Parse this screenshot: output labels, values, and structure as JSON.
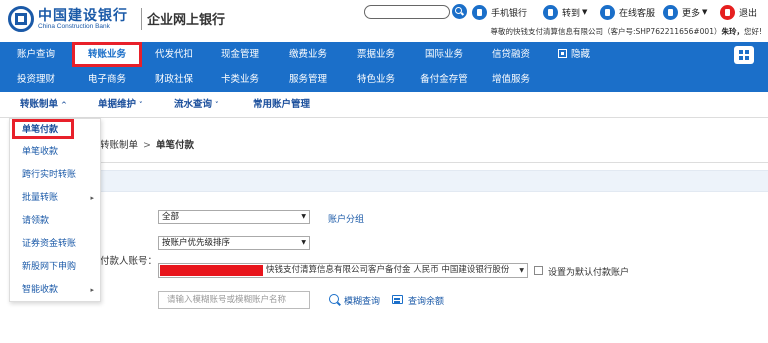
{
  "header": {
    "bank_name_cn": "中国建设银行",
    "bank_name_en": "China Construction Bank",
    "site_name": "企业网上银行",
    "tools": {
      "mobile_bank": "手机银行",
      "go_to": "转到",
      "online_service": "在线客服",
      "more": "更多",
      "logout": "退出"
    },
    "greeting_prefix": "尊敬的快钱支付清算信息有限公司（客户号:SHP762211656#001）",
    "greeting_name": "朱玲，",
    "greeting_suffix": "您好!"
  },
  "nav": {
    "row1": [
      "账户查询",
      "转账业务",
      "代发代扣",
      "现金管理",
      "缴费业务",
      "票据业务",
      "国际业务",
      "信贷融资",
      "隐藏"
    ],
    "row2": [
      "投资理财",
      "电子商务",
      "财政社保",
      "卡类业务",
      "服务管理",
      "特色业务",
      "备付金存管",
      "增值服务"
    ],
    "active": "转账业务"
  },
  "subnav": {
    "items": [
      "转账制单",
      "单据维护",
      "流水查询",
      "常用账户管理"
    ]
  },
  "dropdown": {
    "items": [
      "单笔付款",
      "单笔收款",
      "跨行实时转账",
      "批量转账",
      "请领款",
      "证券资金转账",
      "新股网下申购",
      "智能收款"
    ],
    "active": "单笔付款"
  },
  "breadcrumb": {
    "parent": "转账制单",
    "separator": ">",
    "current": "单笔付款"
  },
  "form": {
    "group_select_value": "全部",
    "account_group_link": "账户分组",
    "sort_select_value": "按账户优先级排序",
    "payer_account_label": "付款人账号：",
    "payer_account_value": "快钱支付清算信息有限公司客户备付金 人民币 中国建设银行股份",
    "default_account_label": "设置为默认付款账户",
    "search_placeholder": "请输入模糊账号或模糊账户名称",
    "fuzzy_search": "模糊查询",
    "query_balance": "查询余额"
  },
  "colors": {
    "brand_blue": "#1b6fc9",
    "highlight_red": "#e8202a"
  }
}
